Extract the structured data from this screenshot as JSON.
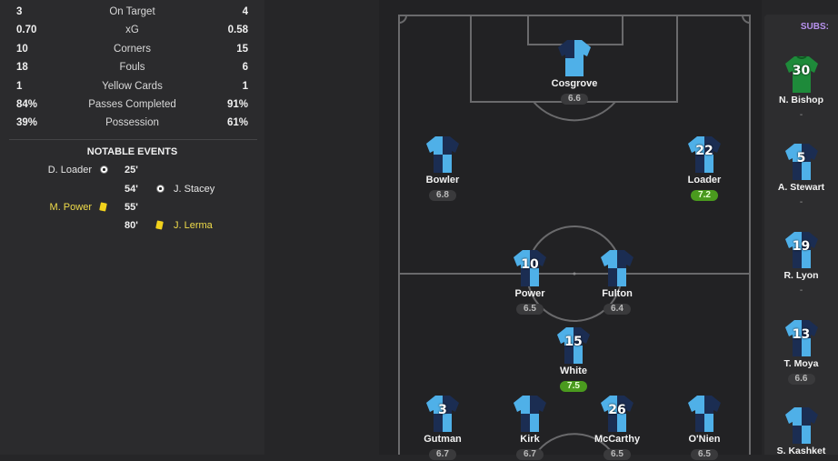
{
  "stats": [
    {
      "home": "3",
      "label": "On Target",
      "away": "4"
    },
    {
      "home": "0.70",
      "label": "xG",
      "away": "0.58"
    },
    {
      "home": "10",
      "label": "Corners",
      "away": "15"
    },
    {
      "home": "18",
      "label": "Fouls",
      "away": "6"
    },
    {
      "home": "1",
      "label": "Yellow Cards",
      "away": "1"
    },
    {
      "home": "84%",
      "label": "Passes Completed",
      "away": "91%"
    },
    {
      "home": "39%",
      "label": "Possession",
      "away": "61%"
    }
  ],
  "events_title": "NOTABLE EVENTS",
  "events": [
    {
      "side": "home",
      "player": "D. Loader",
      "minute": "25'",
      "icon": "goal-ball-icon"
    },
    {
      "side": "away",
      "player": "J. Stacey",
      "minute": "54'",
      "icon": "goal-ball-icon"
    },
    {
      "side": "home",
      "player": "M. Power",
      "minute": "55'",
      "icon": "yellow-card-icon"
    },
    {
      "side": "away",
      "player": "J. Lerma",
      "minute": "80'",
      "icon": "yellow-card-icon"
    }
  ],
  "colors": {
    "rating_good": "#4a9a1e",
    "yellow_card": "#f2d21c",
    "subs_title": "#b892ef",
    "shirt_light": "#4fb0e8",
    "shirt_dark": "#1b2d52",
    "keeper": "#1e8a3a"
  },
  "lineup": [
    {
      "name": "Cosgrove",
      "number": "",
      "rating": "6.6",
      "good": false
    },
    {
      "name": "Bowler",
      "number": "",
      "rating": "6.8",
      "good": false
    },
    {
      "name": "Loader",
      "number": "22",
      "rating": "7.2",
      "good": true
    },
    {
      "name": "Power",
      "number": "10",
      "rating": "6.5",
      "good": false
    },
    {
      "name": "Fulton",
      "number": "",
      "rating": "6.4",
      "good": false
    },
    {
      "name": "White",
      "number": "15",
      "rating": "7.5",
      "good": true
    },
    {
      "name": "Gutman",
      "number": "3",
      "rating": "6.7",
      "good": false
    },
    {
      "name": "Kirk",
      "number": "",
      "rating": "6.7",
      "good": false
    },
    {
      "name": "McCarthy",
      "number": "26",
      "rating": "6.5",
      "good": false
    },
    {
      "name": "O'Nien",
      "number": "",
      "rating": "6.5",
      "good": false
    }
  ],
  "subs_title": "SUBS:",
  "subs": [
    {
      "name": "N. Bishop",
      "number": "30",
      "rating": "-",
      "keeper": true
    },
    {
      "name": "A. Stewart",
      "number": "5",
      "rating": "-",
      "keeper": false
    },
    {
      "name": "R. Lyon",
      "number": "19",
      "rating": "-",
      "keeper": false
    },
    {
      "name": "T. Moya",
      "number": "13",
      "rating": "6.6",
      "keeper": false
    },
    {
      "name": "S. Kashket",
      "number": "",
      "rating": "",
      "keeper": false
    }
  ]
}
